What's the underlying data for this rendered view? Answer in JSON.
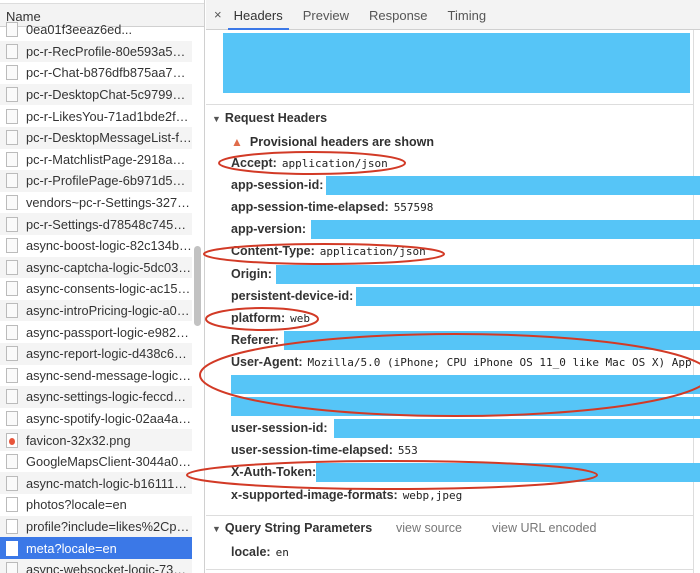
{
  "network_list": {
    "header": "Name",
    "items": [
      {
        "name": "0ea01f3eeaz6ed...",
        "icon": "document-icon"
      },
      {
        "name": "pc-r-RecProfile-80e593a50b0...",
        "icon": "document-icon"
      },
      {
        "name": "pc-r-Chat-b876dfb875aa7b2...",
        "icon": "document-icon"
      },
      {
        "name": "pc-r-DesktopChat-5c979996...",
        "icon": "document-icon"
      },
      {
        "name": "pc-r-LikesYou-71ad1bde2f80...",
        "icon": "document-icon"
      },
      {
        "name": "pc-r-DesktopMessageList-f1...",
        "icon": "document-icon"
      },
      {
        "name": "pc-r-MatchlistPage-2918a3e...",
        "icon": "document-icon"
      },
      {
        "name": "pc-r-ProfilePage-6b971d53b...",
        "icon": "document-icon"
      },
      {
        "name": "vendors~pc-r-Settings-32708...",
        "icon": "document-icon"
      },
      {
        "name": "pc-r-Settings-d78548c745af2...",
        "icon": "document-icon"
      },
      {
        "name": "async-boost-logic-82c134b5...",
        "icon": "document-icon"
      },
      {
        "name": "async-captcha-logic-5dc035...",
        "icon": "document-icon"
      },
      {
        "name": "async-consents-logic-ac15b...",
        "icon": "document-icon"
      },
      {
        "name": "async-introPricing-logic-a0f5...",
        "icon": "document-icon"
      },
      {
        "name": "async-passport-logic-e98250...",
        "icon": "document-icon"
      },
      {
        "name": "async-report-logic-d438c64b...",
        "icon": "document-icon"
      },
      {
        "name": "async-send-message-logic-9...",
        "icon": "document-icon"
      },
      {
        "name": "async-settings-logic-feccd67...",
        "icon": "document-icon"
      },
      {
        "name": "async-spotify-logic-02aa4a5...",
        "icon": "document-icon"
      },
      {
        "name": "favicon-32x32.png",
        "icon": "favicon-icon"
      },
      {
        "name": "GoogleMapsClient-3044a0ae...",
        "icon": "document-icon"
      },
      {
        "name": "async-match-logic-b161112b...",
        "icon": "document-icon"
      },
      {
        "name": "photos?locale=en",
        "icon": "blank-icon"
      },
      {
        "name": "profile?include=likes%2Cplus...",
        "icon": "blank-icon"
      },
      {
        "name": "meta?locale=en",
        "icon": "blank-icon",
        "selected": true
      },
      {
        "name": "async-websocket-logic-7391...",
        "icon": "document-icon"
      }
    ]
  },
  "tabs": {
    "close": "×",
    "items": [
      "Headers",
      "Preview",
      "Response",
      "Timing"
    ],
    "active": "Headers"
  },
  "request_headers": {
    "title": "Request Headers",
    "warning": "Provisional headers are shown",
    "rows": [
      {
        "key": "Accept:",
        "value": "application/json"
      },
      {
        "key": "app-session-id:",
        "value": ""
      },
      {
        "key": "app-session-time-elapsed:",
        "value": "557598"
      },
      {
        "key": "app-version:",
        "value": ""
      },
      {
        "key": "Content-Type:",
        "value": "application/json"
      },
      {
        "key": "Origin:",
        "value": ""
      },
      {
        "key": "persistent-device-id:",
        "value": ""
      },
      {
        "key": "platform:",
        "value": "web"
      },
      {
        "key": "Referer:",
        "value": ""
      },
      {
        "key": "User-Agent:",
        "value": "Mozilla/5.0 (iPhone; CPU iPhone OS 11_0 like Mac OS X) App"
      },
      {
        "key": "",
        "value": ""
      },
      {
        "key": "",
        "value": ""
      },
      {
        "key": "user-session-id:",
        "value": ""
      },
      {
        "key": "user-session-time-elapsed:",
        "value": "553"
      },
      {
        "key": "X-Auth-Token:",
        "value": ""
      },
      {
        "key": "x-supported-image-formats:",
        "value": "webp,jpeg"
      }
    ]
  },
  "query_string": {
    "title": "Query String Parameters",
    "view_source": "view source",
    "view_url_encoded": "view URL encoded",
    "rows": [
      {
        "key": "locale:",
        "value": "en"
      }
    ]
  },
  "colors": {
    "redaction": "#56c5f7",
    "annotation": "#d23a26",
    "selected": "#3b78e7"
  }
}
